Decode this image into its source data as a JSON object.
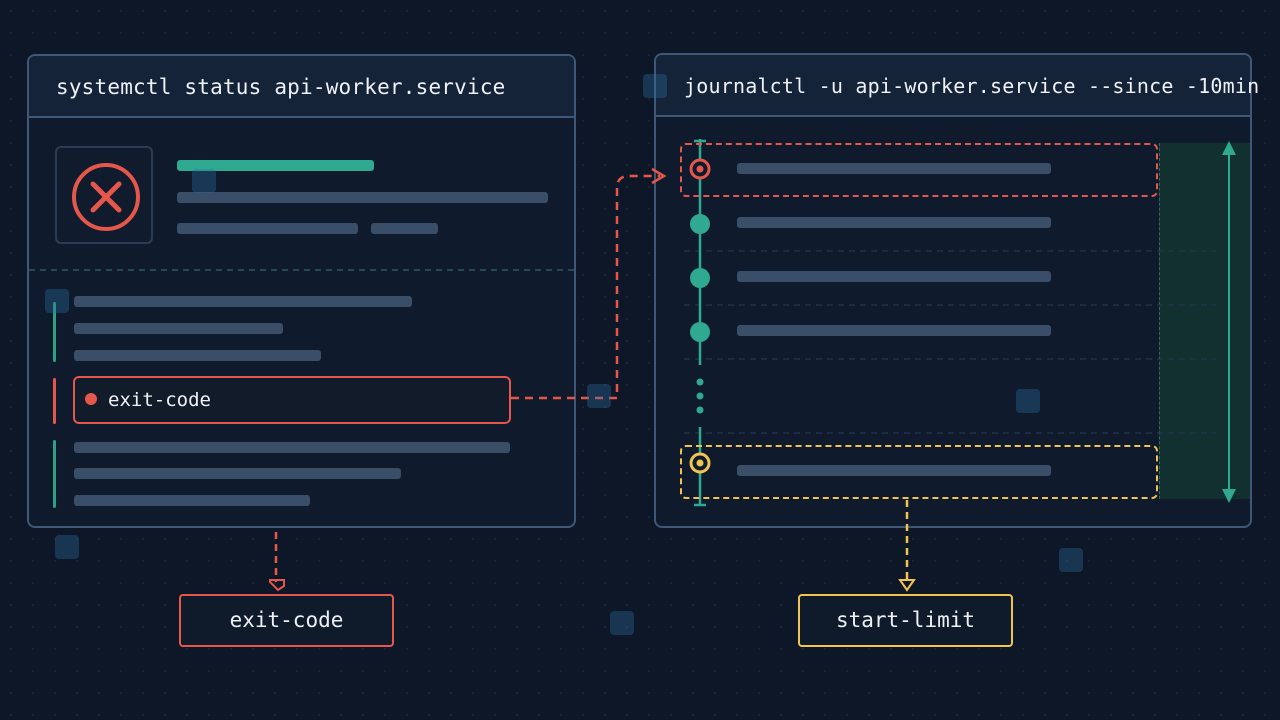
{
  "left_panel": {
    "title": "systemctl status api-worker.service",
    "highlight_label": "exit-code"
  },
  "right_panel": {
    "title": "journalctl -u api-worker.service --since -10min"
  },
  "outputs": {
    "left_tag": "exit-code",
    "right_tag": "start-limit"
  },
  "colors": {
    "background": "#0d1727",
    "panel_border": "#3f5877",
    "error_red": "#e5574a",
    "ok_teal": "#2fa98f",
    "warn_amber": "#f1c350",
    "placeholder_bar": "#3a4e68"
  },
  "icons": {
    "status": "error-x-icon",
    "watermark": "watermark-logo"
  }
}
